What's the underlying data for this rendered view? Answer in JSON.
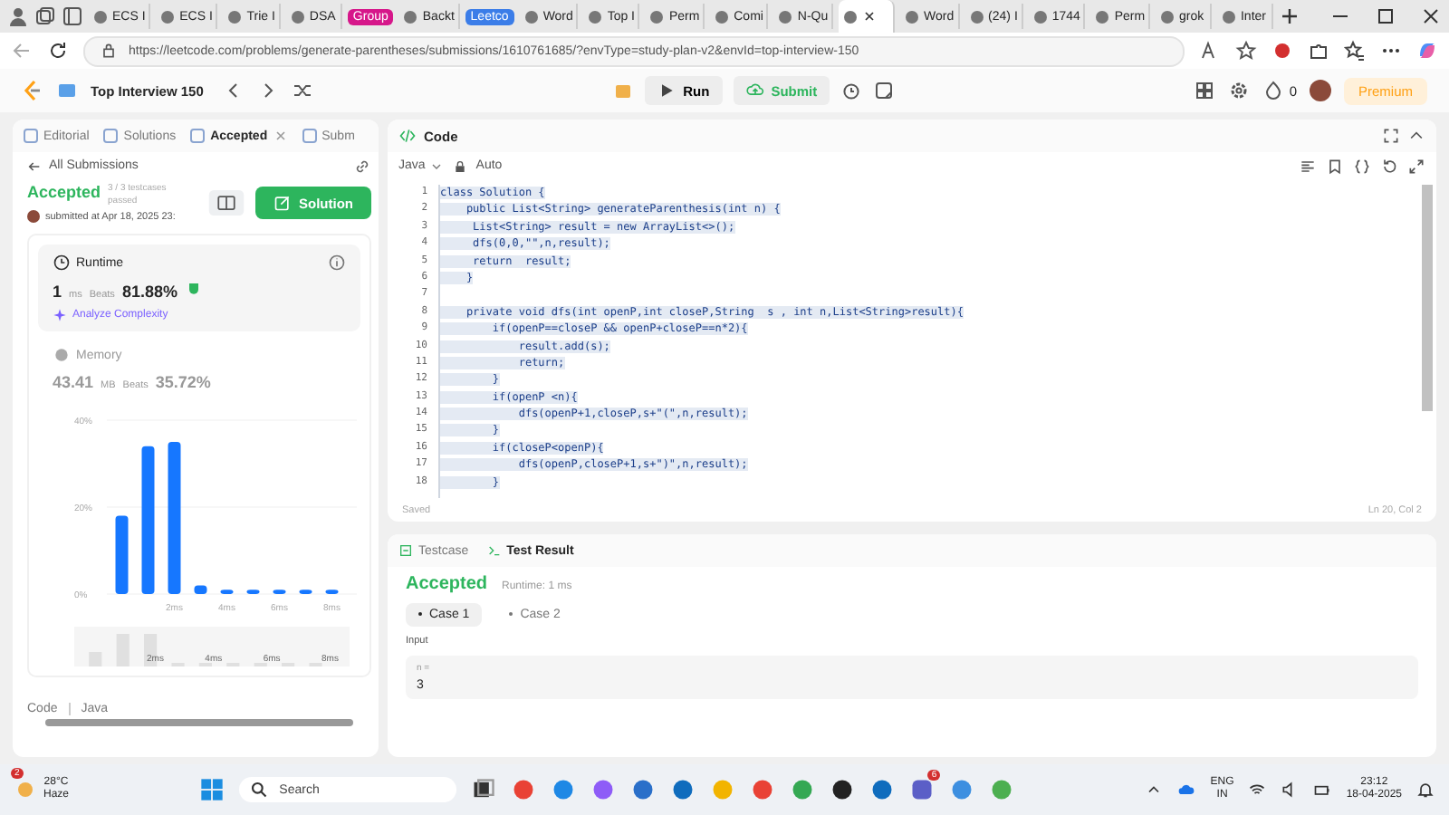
{
  "browser": {
    "tabs": [
      {
        "label": "ECS I",
        "kind": "page",
        "selected": false
      },
      {
        "label": "ECS I",
        "kind": "page",
        "selected": false
      },
      {
        "label": "Trie I",
        "kind": "page",
        "selected": false
      },
      {
        "label": "DSA",
        "kind": "page",
        "selected": false
      },
      {
        "label": "Group",
        "kind": "group",
        "color": "#d6178a"
      },
      {
        "label": "Backt",
        "kind": "page",
        "selected": false
      },
      {
        "label": "Leetco",
        "kind": "group",
        "color": "#3b7de8"
      },
      {
        "label": "Word",
        "kind": "page",
        "selected": false
      },
      {
        "label": "Top I",
        "kind": "page",
        "selected": false
      },
      {
        "label": "Perm",
        "kind": "page",
        "selected": false
      },
      {
        "label": "Comi",
        "kind": "page",
        "selected": false
      },
      {
        "label": "N-Qu",
        "kind": "page",
        "selected": false
      },
      {
        "kind": "page",
        "selected": true
      },
      {
        "label": "Word",
        "kind": "page",
        "selected": false
      },
      {
        "label": "(24) I",
        "kind": "page",
        "selected": false
      },
      {
        "label": "1744",
        "kind": "page",
        "selected": false
      },
      {
        "label": "Perm",
        "kind": "page",
        "selected": false
      },
      {
        "label": "grok",
        "kind": "page",
        "selected": false
      },
      {
        "label": "Inter",
        "kind": "page",
        "selected": false
      }
    ],
    "address": "https://leetcode.com/problems/generate-parentheses/submissions/1610761685/?envType=study-plan-v2&envId=top-interview-150"
  },
  "header": {
    "title": "Top Interview 150",
    "run": "Run",
    "submit": "Submit",
    "streak": "0",
    "premium": "Premium"
  },
  "left": {
    "tabs": [
      {
        "label": "Editorial",
        "selected": false
      },
      {
        "label": "Solutions",
        "selected": false
      },
      {
        "label": "Accepted",
        "selected": true
      },
      {
        "label": "Subm",
        "selected": false
      }
    ],
    "back": "All Submissions",
    "status": "Accepted",
    "testcases": "3 / 3 testcases passed",
    "submitted": "submitted at Apr 18, 2025 23:",
    "solution_button": "Solution",
    "runtime": {
      "label": "Runtime",
      "value": "1",
      "unit": "ms",
      "beats_label": "Beats",
      "beats": "81.88%",
      "link": "Analyze Complexity"
    },
    "memory": {
      "label": "Memory",
      "value": "43.41",
      "unit": "MB",
      "beats_label": "Beats",
      "beats": "35.72%"
    },
    "chart_data": {
      "type": "bar",
      "x": [
        0,
        1,
        2,
        3,
        4,
        5,
        6,
        7,
        8
      ],
      "series": [
        {
          "color": "#1677ff",
          "values": [
            18,
            34,
            35,
            2,
            1,
            1,
            1,
            1,
            1
          ]
        }
      ],
      "xlim": [
        -0.5,
        8.5
      ],
      "ylim": [
        0,
        40
      ],
      "yticks": [
        {
          "value": 0,
          "label": "0%"
        },
        {
          "value": 20,
          "label": "20%"
        },
        {
          "value": 40,
          "label": "40%"
        }
      ],
      "xticks": [
        {
          "value": 2,
          "label": "2ms"
        },
        {
          "value": 4,
          "label": "4ms"
        },
        {
          "value": 6,
          "label": "6ms"
        },
        {
          "value": 8,
          "label": "8ms"
        }
      ]
    },
    "overview_labels": [
      "2ms",
      "4ms",
      "6ms",
      "8ms"
    ],
    "footer": [
      "Code",
      "Java"
    ]
  },
  "code": {
    "title": "Code",
    "language": "Java",
    "mode": "Auto",
    "lines": [
      {
        "number": "1",
        "text": "class Solution {"
      },
      {
        "number": "2",
        "text": "    public List<String> generateParenthesis(int n) {"
      },
      {
        "number": "3",
        "text": "     List<String> result = new ArrayList<>();"
      },
      {
        "number": "4",
        "text": "     dfs(0,0,\"\",n,result);"
      },
      {
        "number": "5",
        "text": "     return  result;"
      },
      {
        "number": "6",
        "text": "    }"
      },
      {
        "number": "7"
      },
      {
        "number": "8",
        "text": "    private void dfs(int openP,int closeP,String  s , int n,List<String>result){"
      },
      {
        "number": "9",
        "text": "        if(openP==closeP && openP+closeP==n*2){"
      },
      {
        "number": "10",
        "text": "            result.add(s);"
      },
      {
        "number": "11",
        "text": "            return;"
      },
      {
        "number": "12",
        "text": "        }"
      },
      {
        "number": "13",
        "text": "        if(openP <n){"
      },
      {
        "number": "14",
        "text": "            dfs(openP+1,closeP,s+\"(\",n,result);"
      },
      {
        "number": "15",
        "text": "        }"
      },
      {
        "number": "16",
        "text": "        if(closeP<openP){"
      },
      {
        "number": "17",
        "text": "            dfs(openP,closeP+1,s+\")\",n,result);"
      },
      {
        "number": "18",
        "text": "        }"
      }
    ],
    "status": "Saved",
    "cursor": "Ln 20, Col 2"
  },
  "result": {
    "tabs": [
      {
        "label": "Testcase",
        "selected": false
      },
      {
        "label": "Test Result",
        "selected": true
      }
    ],
    "status": "Accepted",
    "runtime": "Runtime: 1 ms",
    "cases": [
      {
        "label": "Case 1",
        "selected": true
      },
      {
        "label": "Case 2",
        "selected": false
      }
    ],
    "input_label": "Input",
    "param": "n =",
    "value": "3"
  },
  "taskbar": {
    "weather_badge": "2",
    "temperature": "28°C",
    "condition": "Haze",
    "search": "Search",
    "teams_badge": "6",
    "language": "ENG",
    "region": "IN",
    "time": "23:12",
    "date": "18-04-2025"
  }
}
